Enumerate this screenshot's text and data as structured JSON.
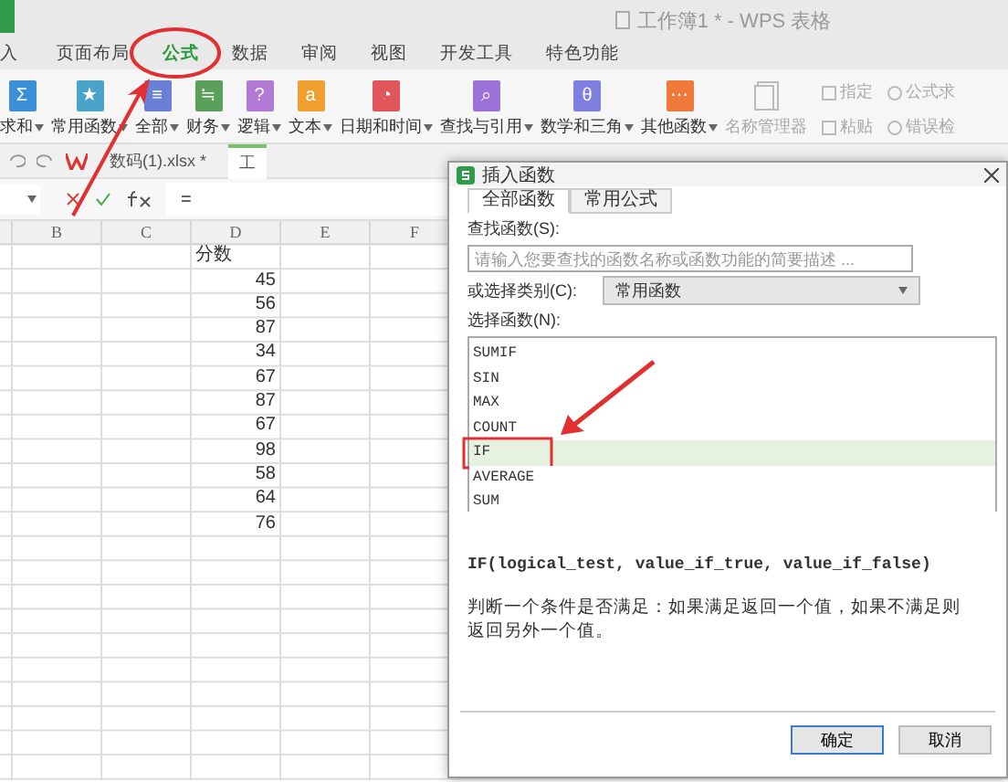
{
  "window": {
    "title": "工作簿1 * - WPS 表格"
  },
  "ribbon_tabs": [
    {
      "label": "入",
      "selected": false
    },
    {
      "label": "页面布局",
      "selected": false
    },
    {
      "label": "公式",
      "selected": true
    },
    {
      "label": "数据",
      "selected": false
    },
    {
      "label": "审阅",
      "selected": false
    },
    {
      "label": "视图",
      "selected": false
    },
    {
      "label": "开发工具",
      "selected": false
    },
    {
      "label": "特色功能",
      "selected": false
    }
  ],
  "ribbon_buttons": [
    {
      "kind": "large",
      "label": "求和",
      "color": "#3b8fd6",
      "glyph": "Σ"
    },
    {
      "kind": "large",
      "label": "常用函数",
      "color": "#4aa3c8",
      "glyph": "★"
    },
    {
      "kind": "large",
      "label": "全部",
      "color": "#6a7fd8",
      "glyph": "≡"
    },
    {
      "kind": "large",
      "label": "财务",
      "color": "#5aa05a",
      "glyph": "≒"
    },
    {
      "kind": "large",
      "label": "逻辑",
      "color": "#b279d6",
      "glyph": "?"
    },
    {
      "kind": "large",
      "label": "文本",
      "color": "#f0a030",
      "glyph": "a"
    },
    {
      "kind": "large",
      "label": "日期和时间",
      "color": "#e0565b",
      "glyph": "◔"
    },
    {
      "kind": "large",
      "label": "查找与引用",
      "color": "#9b72d8",
      "glyph": "⌕"
    },
    {
      "kind": "large",
      "label": "数学和三角",
      "color": "#7f7fe0",
      "glyph": "θ"
    },
    {
      "kind": "large",
      "label": "其他函数",
      "color": "#f07a3c",
      "glyph": "⋯"
    },
    {
      "kind": "plain",
      "label": "名称管理器"
    },
    {
      "kind": "small",
      "label": "指定"
    },
    {
      "kind": "small",
      "label": "粘贴"
    },
    {
      "kind": "small",
      "label": "公式求"
    },
    {
      "kind": "small",
      "label": "错误检"
    }
  ],
  "doc_tabs": [
    {
      "label": "数码(1).xlsx *",
      "selected": false
    },
    {
      "label": "工",
      "selected": true
    }
  ],
  "formula_bar": {
    "value": "="
  },
  "sheet": {
    "columns": [
      "B",
      "C",
      "D",
      "E",
      "F"
    ],
    "rows": [
      {
        "kind": "text",
        "value": "分数"
      },
      {
        "kind": "number",
        "value": "45"
      },
      {
        "kind": "number",
        "value": "56"
      },
      {
        "kind": "number",
        "value": "87"
      },
      {
        "kind": "number",
        "value": "34"
      },
      {
        "kind": "number",
        "value": "67"
      },
      {
        "kind": "number",
        "value": "87"
      },
      {
        "kind": "number",
        "value": "67"
      },
      {
        "kind": "number",
        "value": "98"
      },
      {
        "kind": "number",
        "value": "58"
      },
      {
        "kind": "number",
        "value": "64"
      },
      {
        "kind": "number",
        "value": "76"
      }
    ]
  },
  "dialog": {
    "title": "插入函数",
    "tabs": [
      {
        "label": "全部函数",
        "selected": true
      },
      {
        "label": "常用公式",
        "selected": false
      }
    ],
    "search_label": "查找函数(S):",
    "search_placeholder": "请输入您要查找的函数名称或函数功能的简要描述 ...",
    "category_label": "或选择类别(C):",
    "category_value": "常用函数",
    "list_label": "选择函数(N):",
    "functions": [
      {
        "name": "SUMIF",
        "selected": false
      },
      {
        "name": "SIN",
        "selected": false
      },
      {
        "name": "MAX",
        "selected": false
      },
      {
        "name": "COUNT",
        "selected": false
      },
      {
        "name": "IF",
        "selected": true
      },
      {
        "name": "AVERAGE",
        "selected": false
      },
      {
        "name": "SUM",
        "selected": false
      }
    ],
    "signature": "IF(logical_test, value_if_true, value_if_false)",
    "description": "判断一个条件是否满足：如果满足返回一个值，如果不满足则返回另外一个值。",
    "buttons": [
      {
        "label": "确定",
        "focused": true
      },
      {
        "label": "取消",
        "focused": false
      }
    ]
  }
}
